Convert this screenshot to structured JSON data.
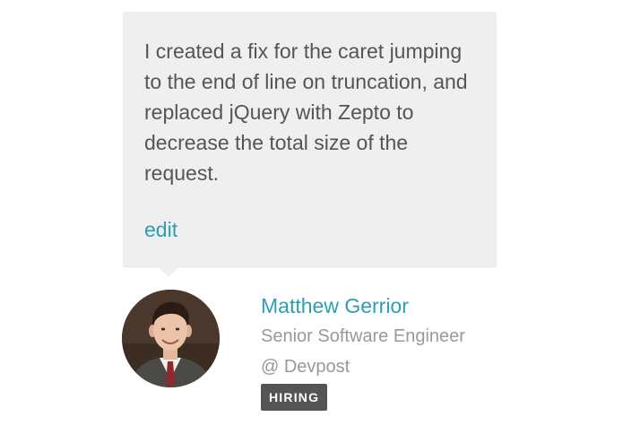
{
  "update": {
    "text": "I created a fix for the caret jumping to the end of line on truncation, and replaced jQuery with Zepto to decrease the total size of the request.",
    "edit_label": "edit"
  },
  "author": {
    "name": "Matthew Gerrior",
    "role": "Senior Software Engineer",
    "company": "@ Devpost",
    "badge": "HIRING",
    "avatar_icon": "profile-photo"
  },
  "colors": {
    "link": "#2c9fb1",
    "bubble_bg": "#efefef",
    "body_text": "#555555",
    "muted_text": "#999999",
    "badge_bg": "#555555"
  }
}
